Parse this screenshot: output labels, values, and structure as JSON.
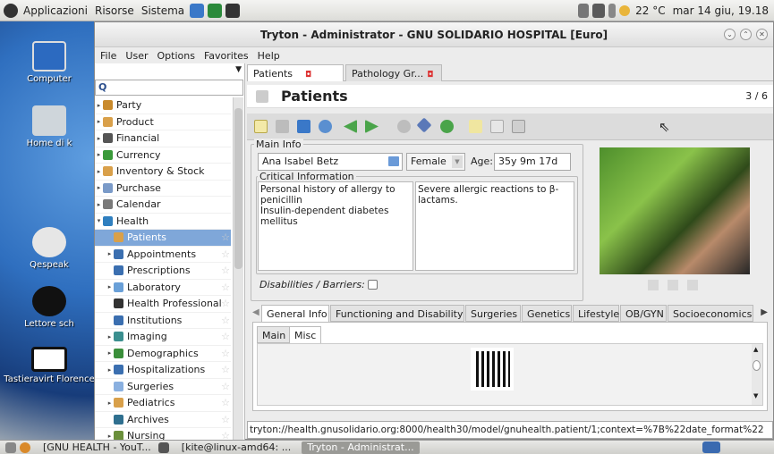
{
  "top_panel": {
    "menus": [
      "Applicazioni",
      "Risorse",
      "Sistema"
    ],
    "weather": "22 °C",
    "clock": "mar 14 giu, 19.18"
  },
  "desktop": {
    "icons": [
      "Computer",
      "Home di k",
      "Qespeak",
      "Lettore sch",
      "Tastieravirt Florence"
    ]
  },
  "window": {
    "title": "Tryton - Administrator - GNU SOLIDARIO HOSPITAL [Euro]",
    "menubar": [
      "File",
      "User",
      "Options",
      "Favorites",
      "Help"
    ]
  },
  "sidebar": {
    "search_placeholder": "",
    "items": [
      {
        "label": "Party",
        "icon": "party-icon",
        "color": "#c98a2c",
        "expander": "▸",
        "selected": false
      },
      {
        "label": "Product",
        "icon": "product-icon",
        "color": "#d9a04a",
        "expander": "▸",
        "selected": false
      },
      {
        "label": "Financial",
        "icon": "financial-icon",
        "color": "#555555",
        "expander": "▸",
        "selected": false
      },
      {
        "label": "Currency",
        "icon": "currency-icon",
        "color": "#3a9a3a",
        "expander": "▸",
        "selected": false
      },
      {
        "label": "Inventory & Stock",
        "icon": "inventory-icon",
        "color": "#d9a04a",
        "expander": "▸",
        "selected": false
      },
      {
        "label": "Purchase",
        "icon": "purchase-icon",
        "color": "#7a9ac8",
        "expander": "▸",
        "selected": false
      },
      {
        "label": "Calendar",
        "icon": "calendar-icon",
        "color": "#7a7a7a",
        "expander": "▸",
        "selected": false
      },
      {
        "label": "Health",
        "icon": "health-icon",
        "color": "#2f7fbf",
        "expander": "▾",
        "selected": false
      },
      {
        "label": "Patients",
        "icon": "patient-icon",
        "color": "#d9a04a",
        "expander": "",
        "selected": true
      },
      {
        "label": "Appointments",
        "icon": "appointments-icon",
        "color": "#3b6fb0",
        "expander": "▸",
        "selected": false
      },
      {
        "label": "Prescriptions",
        "icon": "prescriptions-icon",
        "color": "#3b6fb0",
        "expander": "",
        "selected": false
      },
      {
        "label": "Laboratory",
        "icon": "laboratory-icon",
        "color": "#6aa0d8",
        "expander": "▸",
        "selected": false
      },
      {
        "label": "Health Professional",
        "icon": "professional-icon",
        "color": "#333333",
        "expander": "",
        "selected": false
      },
      {
        "label": "Institutions",
        "icon": "institutions-icon",
        "color": "#3b6fb0",
        "expander": "",
        "selected": false
      },
      {
        "label": "Imaging",
        "icon": "imaging-icon",
        "color": "#3b8f8f",
        "expander": "▸",
        "selected": false
      },
      {
        "label": "Demographics",
        "icon": "demographics-icon",
        "color": "#3b8f3b",
        "expander": "▸",
        "selected": false
      },
      {
        "label": "Hospitalizations",
        "icon": "hospitalizations-icon",
        "color": "#3b6fb0",
        "expander": "▸",
        "selected": false
      },
      {
        "label": "Surgeries",
        "icon": "surgeries-icon",
        "color": "#8ab0e0",
        "expander": "",
        "selected": false
      },
      {
        "label": "Pediatrics",
        "icon": "pediatrics-icon",
        "color": "#d9a04a",
        "expander": "▸",
        "selected": false
      },
      {
        "label": "Archives",
        "icon": "archives-icon",
        "color": "#2f6f8f",
        "expander": "",
        "selected": false
      },
      {
        "label": "Nursing",
        "icon": "nursing-icon",
        "color": "#6a8f3b",
        "expander": "▸",
        "selected": false
      }
    ]
  },
  "tabs": [
    {
      "label": "Patients",
      "active": true
    },
    {
      "label": "Pathology Gr...",
      "active": false
    }
  ],
  "header": {
    "title": "Patients",
    "record_count": "3 / 6"
  },
  "form": {
    "main_info_label": "Main Info",
    "patient_name": "Ana Isabel Betz",
    "gender": "Female",
    "age_label": "Age:",
    "age_value": "35y 9m 17d",
    "critical_label": "Critical Information",
    "critical_left": "Personal history of allergy to penicillin\nInsulin-dependent diabetes mellitus",
    "critical_right": "Severe allergic reactions to β-lactams.",
    "disabilities_label": "Disabilities / Barriers:"
  },
  "bottom_tabs": [
    "General Info",
    "Functioning and Disability",
    "Surgeries",
    "Genetics",
    "Lifestyle",
    "OB/GYN",
    "Socioeconomics"
  ],
  "sub_tabs": [
    "Main",
    "Misc"
  ],
  "url": "tryton://health.gnusolidario.org:8000/health30/model/gnuhealth.patient/1;context=%7B%22date_format%22",
  "taskbar": {
    "items": [
      "[GNU HEALTH - YouT...",
      "[kite@linux-amd64: ...",
      "Tryton - Administrat..."
    ]
  }
}
